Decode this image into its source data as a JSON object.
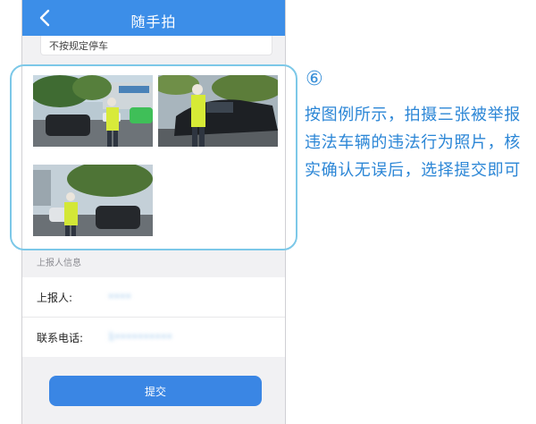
{
  "app": {
    "title": "随手拍",
    "back_icon": "chevron-left-icon",
    "accent_color": "#3c8ee8"
  },
  "report": {
    "description": "不按规定停车"
  },
  "photos": [
    {
      "name": "violation-photo-1"
    },
    {
      "name": "violation-photo-2"
    },
    {
      "name": "violation-photo-3"
    }
  ],
  "reporter_section": {
    "title": "上报人信息",
    "name_label": "上报人:",
    "name_value": "••••",
    "phone_label": "联系电话:",
    "phone_value": "1••••••••••"
  },
  "submit": {
    "label": "提交"
  },
  "annotation": {
    "step": "⑥",
    "text": "按图例所示，拍摄三张被举报违法车辆的违法行为照片，核实确认无误后，选择提交即可",
    "color": "#2b86d6"
  }
}
